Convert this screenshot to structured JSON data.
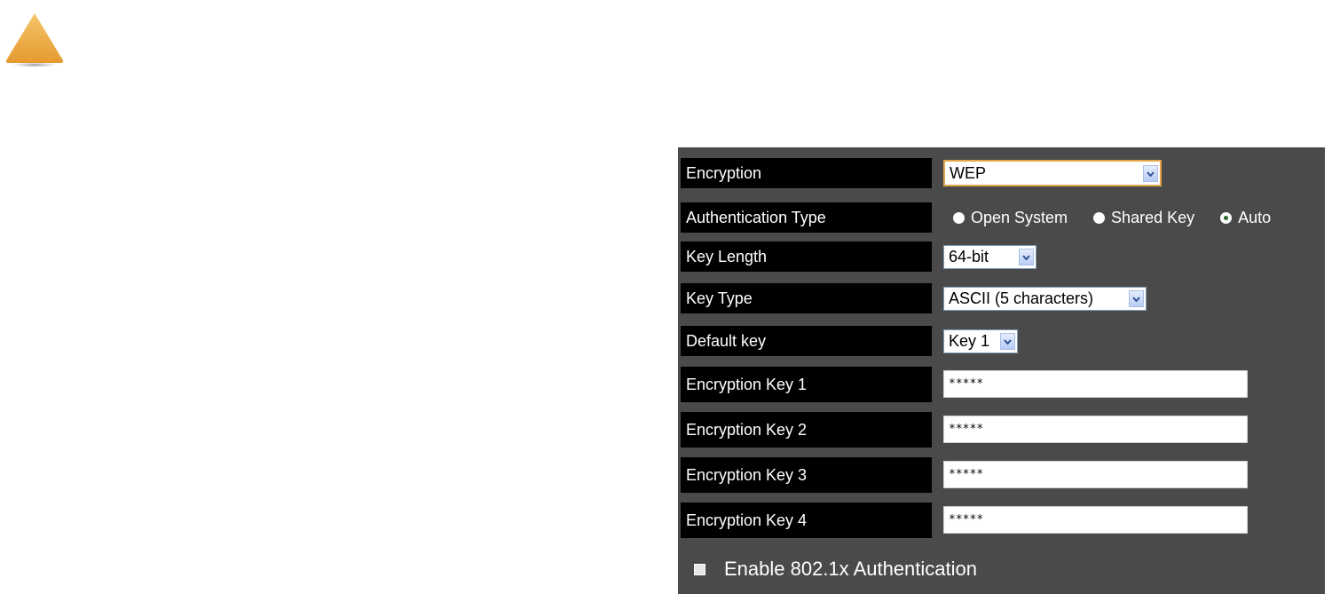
{
  "icons": {
    "warning": "warning-triangle-icon"
  },
  "colors": {
    "panel_bg": "#4a4a4a",
    "label_bg": "#000000",
    "warning_orange": "#f0b04a"
  },
  "encryption": {
    "label": "Encryption",
    "value": "WEP"
  },
  "authentication": {
    "label": "Authentication Type",
    "options": [
      "Open System",
      "Shared Key",
      "Auto"
    ],
    "selected": "Auto"
  },
  "key_length": {
    "label": "Key Length",
    "value": "64-bit"
  },
  "key_type": {
    "label": "Key Type",
    "value": "ASCII (5 characters)"
  },
  "default_key": {
    "label": "Default key",
    "value": "Key 1"
  },
  "keys": [
    {
      "label": "Encryption Key 1",
      "value": "*****"
    },
    {
      "label": "Encryption Key 2",
      "value": "*****"
    },
    {
      "label": "Encryption Key 3",
      "value": "*****"
    },
    {
      "label": "Encryption Key 4",
      "value": "*****"
    }
  ],
  "enable_8021x": {
    "label": "Enable 802.1x Authentication",
    "checked": false
  }
}
